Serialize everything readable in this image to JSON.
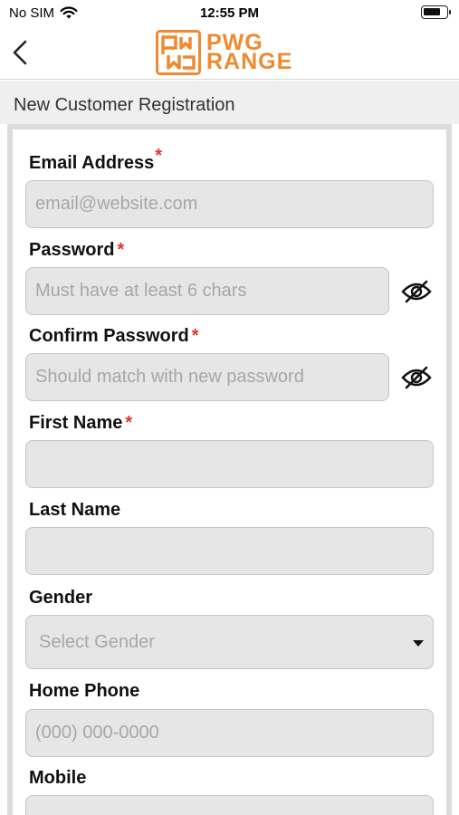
{
  "status_bar": {
    "carrier": "No SIM",
    "time": "12:55 PM"
  },
  "brand": {
    "line1": "PWG",
    "line2": "RANGE",
    "color": "#ef8a2e"
  },
  "page_title": "New Customer Registration",
  "form": {
    "email": {
      "label": "Email Address",
      "placeholder": "email@website.com",
      "required": "*"
    },
    "password": {
      "label": "Password",
      "placeholder": "Must have at least 6 chars",
      "required": "*"
    },
    "confirm_password": {
      "label": "Confirm Password",
      "placeholder": "Should match with new password",
      "required": "*"
    },
    "first_name": {
      "label": "First Name",
      "required": "*"
    },
    "last_name": {
      "label": "Last Name"
    },
    "gender": {
      "label": "Gender",
      "placeholder": "Select Gender"
    },
    "home_phone": {
      "label": "Home Phone",
      "placeholder": "(000) 000-0000"
    },
    "mobile": {
      "label": "Mobile"
    }
  },
  "icons": {
    "wifi": "wifi-icon",
    "battery": "battery-icon",
    "back": "chevron-left-icon",
    "eye_off": "eye-off-icon",
    "dropdown": "caret-down-icon"
  },
  "colors": {
    "required": "#e0342b",
    "field_bg": "#e6e6e6"
  }
}
